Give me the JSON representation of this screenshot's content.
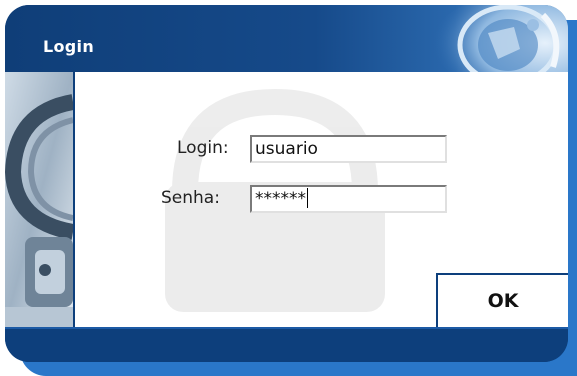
{
  "dialog": {
    "title": "Login"
  },
  "form": {
    "login_label": "Login:",
    "login_value": "usuario",
    "password_label": "Senha:",
    "password_value": "******"
  },
  "actions": {
    "ok_label": "OK"
  },
  "colors": {
    "frame": "#0d3f7c",
    "shadow": "#2a77c9",
    "content_bg": "#ffffff"
  }
}
